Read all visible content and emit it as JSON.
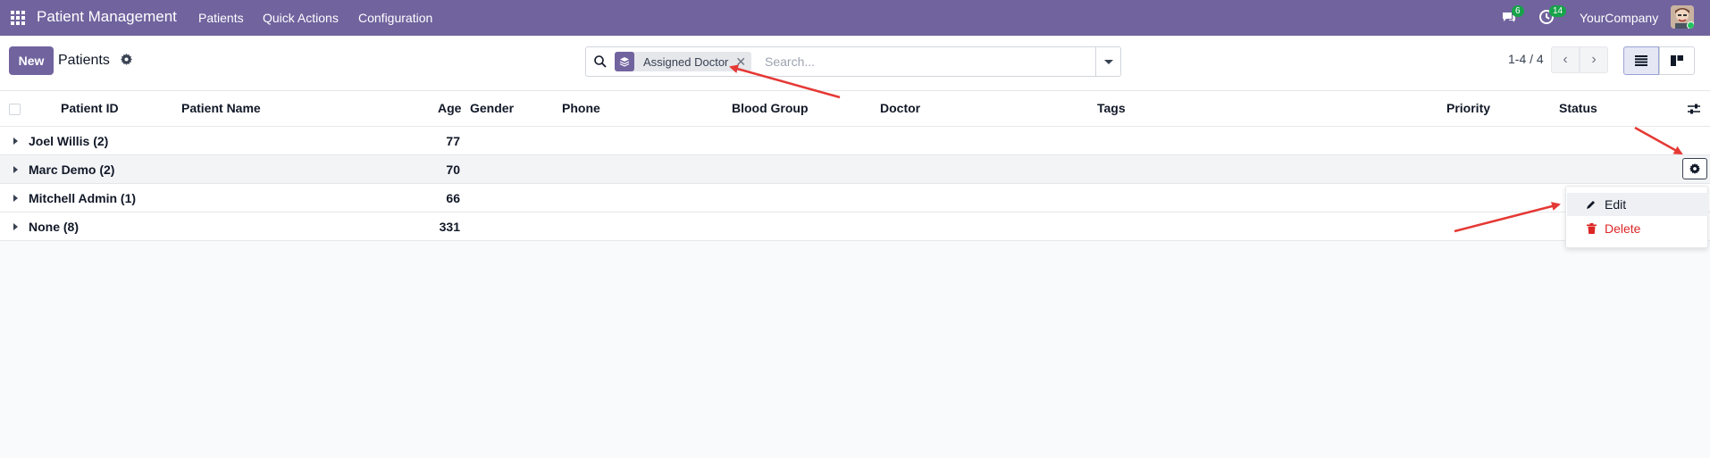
{
  "navbar": {
    "brand": "Patient Management",
    "menus": [
      "Patients",
      "Quick Actions",
      "Configuration"
    ],
    "messages_count": "6",
    "activities_count": "14",
    "company": "YourCompany"
  },
  "control_panel": {
    "new_label": "New",
    "title": "Patients",
    "search": {
      "facet_label": "Assigned Doctor",
      "placeholder": "Search..."
    },
    "pager": "1-4 / 4"
  },
  "table": {
    "columns": [
      "Patient ID",
      "Patient Name",
      "Age",
      "Gender",
      "Phone",
      "Blood Group",
      "Doctor",
      "Tags",
      "Priority",
      "Status"
    ],
    "groups": [
      {
        "name": "Joel Willis (2)",
        "age_sum": "77"
      },
      {
        "name": "Marc Demo (2)",
        "age_sum": "70"
      },
      {
        "name": "Mitchell Admin (1)",
        "age_sum": "66"
      },
      {
        "name": "None (8)",
        "age_sum": "331"
      }
    ]
  },
  "row_menu": {
    "edit_label": "Edit",
    "delete_label": "Delete"
  },
  "colors": {
    "brand": "#71639e",
    "danger": "#dc2626",
    "badge": "#17a34a",
    "annotation_arrow": "#e53935"
  }
}
